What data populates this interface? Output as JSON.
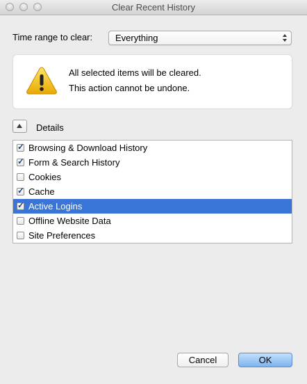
{
  "window": {
    "title": "Clear Recent History"
  },
  "time_range": {
    "label": "Time range to clear:",
    "selected": "Everything"
  },
  "warning": {
    "icon": "warning-triangle-icon",
    "line1": "All selected items will be cleared.",
    "line2": "This action cannot be undone."
  },
  "details": {
    "label": "Details",
    "expanded": true
  },
  "items": [
    {
      "label": "Browsing & Download History",
      "checked": true,
      "selected": false
    },
    {
      "label": "Form & Search History",
      "checked": true,
      "selected": false
    },
    {
      "label": "Cookies",
      "checked": false,
      "selected": false
    },
    {
      "label": "Cache",
      "checked": true,
      "selected": false
    },
    {
      "label": "Active Logins",
      "checked": true,
      "selected": true
    },
    {
      "label": "Offline Website Data",
      "checked": false,
      "selected": false
    },
    {
      "label": "Site Preferences",
      "checked": false,
      "selected": false
    }
  ],
  "buttons": {
    "cancel": "Cancel",
    "ok": "OK"
  },
  "colors": {
    "selection": "#3875d7",
    "default_button": "#7db3ef",
    "warning_yellow": "#f5c518"
  }
}
